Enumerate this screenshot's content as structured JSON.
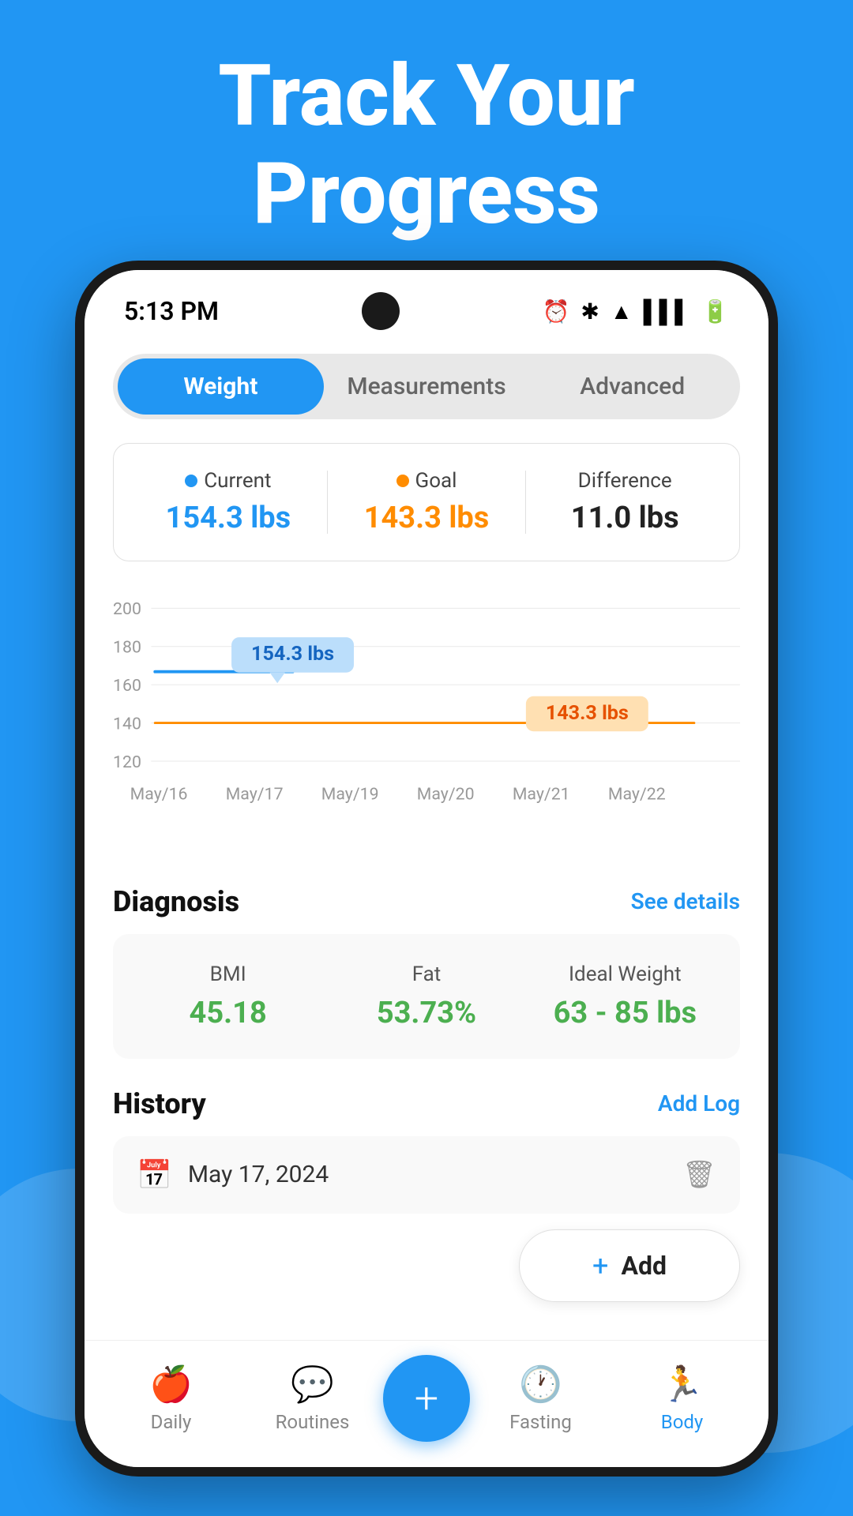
{
  "header": {
    "line1": "Track Your",
    "line2": "Progress"
  },
  "statusBar": {
    "time": "5:13 PM",
    "icons": [
      "⏰",
      "✱",
      "▲",
      "▌▌▌",
      "🔋"
    ]
  },
  "tabs": [
    {
      "label": "Weight",
      "active": true
    },
    {
      "label": "Measurements",
      "active": false
    },
    {
      "label": "Advanced",
      "active": false
    }
  ],
  "summary": {
    "current": {
      "label": "Current",
      "value": "154.3 lbs"
    },
    "goal": {
      "label": "Goal",
      "value": "143.3 lbs"
    },
    "difference": {
      "label": "Difference",
      "value": "11.0 lbs"
    }
  },
  "chart": {
    "yLabels": [
      "200",
      "180",
      "160",
      "140",
      "120"
    ],
    "xLabels": [
      "May/16",
      "May/17",
      "May/19",
      "May/20",
      "May/21",
      "May/22"
    ],
    "currentLabel": "154.3 lbs",
    "goalLabel": "143.3 lbs"
  },
  "diagnosis": {
    "title": "Diagnosis",
    "link": "See details",
    "bmi": {
      "label": "BMI",
      "value": "45.18"
    },
    "fat": {
      "label": "Fat",
      "value": "53.73%"
    },
    "idealWeight": {
      "label": "Ideal Weight",
      "value": "63 - 85 lbs"
    }
  },
  "history": {
    "title": "History",
    "link": "Add Log",
    "date": "May 17, 2024"
  },
  "addButton": {
    "label": "Add"
  },
  "bottomNav": [
    {
      "label": "Daily",
      "icon": "🍎",
      "active": false
    },
    {
      "label": "Routines",
      "icon": "💬",
      "active": false
    },
    {
      "label": "",
      "icon": "+",
      "fab": true
    },
    {
      "label": "Fasting",
      "icon": "🕐",
      "active": false
    },
    {
      "label": "Body",
      "icon": "🏃",
      "active": true
    }
  ]
}
